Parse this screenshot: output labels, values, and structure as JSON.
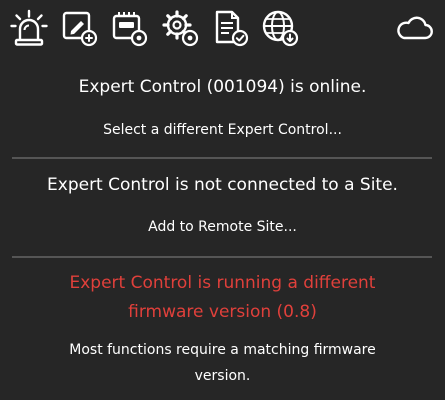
{
  "toolbar": {
    "buttons": [
      {
        "icon": "siren-icon"
      },
      {
        "icon": "device-edit-icon"
      },
      {
        "icon": "device-settings-icon"
      },
      {
        "icon": "gears-icon"
      },
      {
        "icon": "document-check-icon"
      },
      {
        "icon": "globe-download-icon"
      },
      {
        "icon": "cloud-icon"
      }
    ]
  },
  "status": {
    "online_text": "Expert Control (001094) is online.",
    "select_link": "Select a different Expert Control...",
    "site_text": "Expert Control is not connected to a Site.",
    "add_site_link": "Add to Remote Site...",
    "firmware_warning_line1": "Expert Control is running a different",
    "firmware_warning_line2": "firmware version (0.8)",
    "firmware_note_line1": "Most functions require a matching firmware",
    "firmware_note_line2": "version."
  },
  "colors": {
    "background": "#262626",
    "text": "#ffffff",
    "warning": "#e0403b",
    "divider": "#555555"
  }
}
